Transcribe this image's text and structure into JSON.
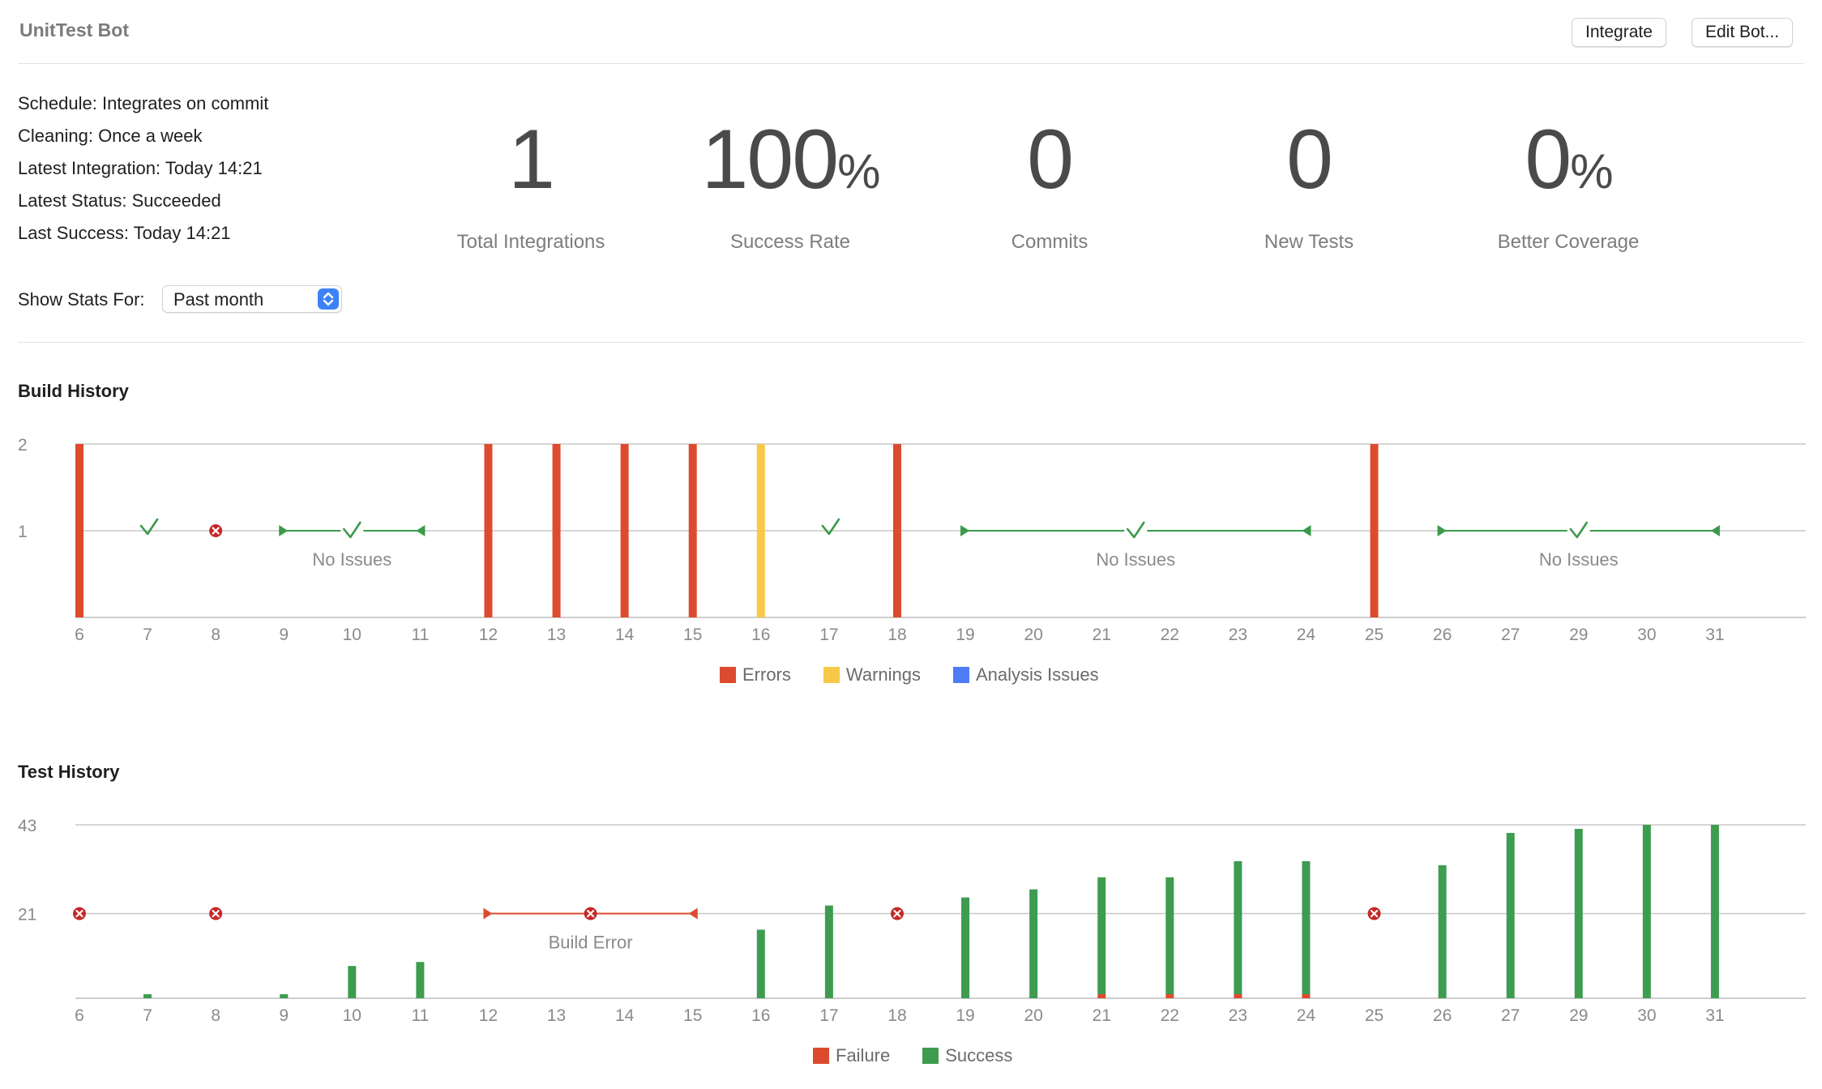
{
  "header": {
    "title": "UnitTest Bot",
    "integrate_label": "Integrate",
    "edit_label": "Edit Bot..."
  },
  "info": {
    "schedule": "Schedule: Integrates on commit",
    "cleaning": "Cleaning: Once a week",
    "latest_integration": "Latest Integration: Today 14:21",
    "latest_status": "Latest Status: Succeeded",
    "last_success": "Last Success: Today 14:21",
    "stats_label": "Show Stats For:",
    "stats_value": "Past month"
  },
  "stats": [
    {
      "value": "1",
      "unit": "",
      "label": "Total Integrations"
    },
    {
      "value": "100",
      "unit": "%",
      "label": "Success Rate"
    },
    {
      "value": "0",
      "unit": "",
      "label": "Commits"
    },
    {
      "value": "0",
      "unit": "",
      "label": "New Tests"
    },
    {
      "value": "0",
      "unit": "%",
      "label": "Better Coverage"
    }
  ],
  "build_history": {
    "title": "Build History",
    "legend": [
      "Errors",
      "Warnings",
      "Analysis Issues"
    ],
    "colors": {
      "Errors": "#dd4b2f",
      "Warnings": "#f7c948",
      "Analysis Issues": "#4f7cf6",
      "ok": "#3b9a4a",
      "fail_icon": "#c62828"
    }
  },
  "test_history": {
    "title": "Test History",
    "legend": [
      "Failure",
      "Success"
    ],
    "colors": {
      "Failure": "#dd4b2f",
      "Success": "#3e9c50"
    }
  },
  "chart_data": [
    {
      "type": "bar",
      "title": "Build History",
      "categories": [
        "6",
        "7",
        "8",
        "9",
        "10",
        "11",
        "12",
        "13",
        "14",
        "15",
        "16",
        "17",
        "18",
        "19",
        "20",
        "21",
        "22",
        "23",
        "24",
        "25",
        "26",
        "27",
        "29",
        "30",
        "31"
      ],
      "yticks": [
        1,
        2
      ],
      "ylim": [
        0,
        2
      ],
      "series": [
        {
          "name": "Errors",
          "values": [
            2,
            0,
            0,
            0,
            0,
            0,
            2,
            2,
            2,
            2,
            0,
            0,
            2,
            0,
            0,
            0,
            0,
            0,
            0,
            2,
            0,
            0,
            0,
            0,
            0
          ]
        },
        {
          "name": "Warnings",
          "values": [
            0,
            0,
            0,
            0,
            0,
            0,
            0,
            0,
            0,
            0,
            2,
            0,
            0,
            0,
            0,
            0,
            0,
            0,
            0,
            0,
            0,
            0,
            0,
            0,
            0
          ]
        },
        {
          "name": "Analysis Issues",
          "values": [
            0,
            0,
            0,
            0,
            0,
            0,
            0,
            0,
            0,
            0,
            0,
            0,
            0,
            0,
            0,
            0,
            0,
            0,
            0,
            0,
            0,
            0,
            0,
            0,
            0
          ]
        }
      ],
      "checks": [
        "7",
        "17"
      ],
      "fails": [
        "8"
      ],
      "ranges": [
        {
          "from": "9",
          "to": "11",
          "label": "No Issues"
        },
        {
          "from": "19",
          "to": "24",
          "label": "No Issues"
        },
        {
          "from": "26",
          "to": "31",
          "label": "No Issues"
        }
      ]
    },
    {
      "type": "bar",
      "title": "Test History",
      "categories": [
        "6",
        "7",
        "8",
        "9",
        "10",
        "11",
        "12",
        "13",
        "14",
        "15",
        "16",
        "17",
        "18",
        "19",
        "20",
        "21",
        "22",
        "23",
        "24",
        "25",
        "26",
        "27",
        "29",
        "30",
        "31"
      ],
      "yticks": [
        21,
        43
      ],
      "ylim": [
        0,
        43
      ],
      "series": [
        {
          "name": "Failure",
          "values": [
            0,
            0,
            0,
            0,
            0,
            0,
            0,
            0,
            0,
            0,
            0,
            0,
            0,
            0,
            0,
            1,
            1,
            1,
            1,
            0,
            0,
            0,
            0,
            0,
            0
          ]
        },
        {
          "name": "Success",
          "values": [
            0,
            1,
            0,
            1,
            8,
            9,
            0,
            0,
            0,
            0,
            17,
            23,
            0,
            25,
            27,
            29,
            29,
            33,
            33,
            0,
            33,
            41,
            42,
            43,
            43
          ]
        }
      ],
      "fails": [
        "6",
        "8",
        "18",
        "25"
      ],
      "ranges": [
        {
          "from": "12",
          "to": "15",
          "label": "Build Error"
        }
      ]
    }
  ]
}
